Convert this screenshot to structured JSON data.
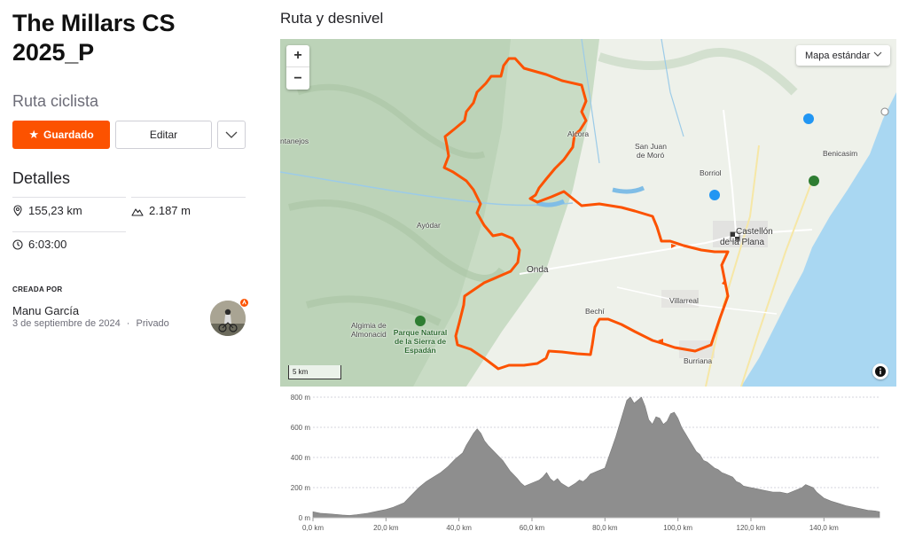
{
  "route": {
    "title": "The Millars CS 2025_P",
    "type": "Ruta ciclista"
  },
  "actions": {
    "saved_label": "Guardado",
    "edit_label": "Editar"
  },
  "details": {
    "heading": "Detalles",
    "distance": "155,23 km",
    "elevation": "2.187 m",
    "time": "6:03:00"
  },
  "creator": {
    "label": "CREADA POR",
    "name": "Manu García",
    "date": "3 de septiembre de 2024",
    "separator": "·",
    "privacy": "Privado"
  },
  "map": {
    "section_title": "Ruta y desnivel",
    "zoom_in": "+",
    "zoom_out": "−",
    "style_select": "Mapa estándar",
    "scale_label": "5 km",
    "labels": {
      "alcora": "Alcora",
      "san_juan": "San Juan",
      "de_moro": "de Moró",
      "borriol": "Borriol",
      "benicasim": "Benicasim",
      "castellon_1": "Castellón",
      "castellon_2": "de la Plana",
      "onda": "Onda",
      "villarreal": "Villarreal",
      "bechi": "Bechí",
      "burriana": "Burriana",
      "ayodar": "Ayódar",
      "algimia_1": "Algimia de",
      "algimia_2": "Almonacid",
      "park_1": "Parque Natural",
      "park_2": "de la Sierra de",
      "park_3": "Espadán",
      "tanejos": "ntanejos"
    },
    "route_color": "#fc5200"
  },
  "chart_data": {
    "type": "area",
    "title": "",
    "xlabel": "",
    "ylabel": "",
    "xlim": [
      0,
      155.23
    ],
    "ylim": [
      0,
      800
    ],
    "x_ticks": [
      0,
      20,
      40,
      60,
      80,
      100,
      120,
      140
    ],
    "x_tick_labels": [
      "0,0 km",
      "20,0 km",
      "40,0 km",
      "60,0 km",
      "80,0 km",
      "100,0 km",
      "120,0 km",
      "140,0 km"
    ],
    "y_ticks": [
      0,
      200,
      400,
      600,
      800
    ],
    "y_tick_labels": [
      "0 m",
      "200 m",
      "400 m",
      "600 m",
      "800 m"
    ],
    "grid": true,
    "fill_color": "#8e8e8e",
    "series": [
      {
        "x": [
          0,
          2,
          5,
          8,
          10,
          12,
          15,
          18,
          20,
          22,
          25,
          27,
          29,
          31,
          33,
          35,
          37,
          39,
          41,
          42,
          43,
          44,
          45,
          46,
          47,
          48,
          50,
          52,
          54,
          56,
          57,
          58,
          60,
          62,
          63,
          64,
          65,
          66,
          67,
          68,
          70,
          72,
          73,
          74,
          75,
          76,
          77,
          78,
          79,
          80,
          81,
          82,
          83,
          84,
          85,
          86,
          87,
          88,
          89,
          90,
          91,
          92,
          93,
          94,
          95,
          96,
          97,
          98,
          99,
          100,
          101,
          102,
          103,
          104,
          105,
          106,
          107,
          108,
          109,
          110,
          111,
          112,
          113,
          114,
          115,
          116,
          117,
          118,
          120,
          122,
          124,
          126,
          128,
          130,
          132,
          134,
          135,
          136,
          137,
          138,
          140,
          142,
          144,
          146,
          148,
          150,
          152,
          154,
          155.23
        ],
        "y": [
          40,
          30,
          25,
          18,
          15,
          20,
          30,
          45,
          55,
          70,
          100,
          150,
          200,
          240,
          270,
          300,
          340,
          390,
          430,
          480,
          520,
          560,
          590,
          560,
          510,
          480,
          430,
          380,
          310,
          260,
          230,
          210,
          230,
          250,
          270,
          300,
          260,
          240,
          260,
          230,
          200,
          230,
          250,
          240,
          260,
          290,
          300,
          310,
          320,
          330,
          400,
          470,
          540,
          620,
          700,
          780,
          800,
          760,
          780,
          800,
          740,
          650,
          620,
          670,
          660,
          620,
          640,
          690,
          700,
          660,
          600,
          560,
          520,
          480,
          440,
          420,
          380,
          370,
          350,
          330,
          320,
          300,
          290,
          280,
          270,
          240,
          230,
          210,
          200,
          190,
          180,
          170,
          170,
          160,
          180,
          200,
          220,
          210,
          200,
          170,
          130,
          110,
          95,
          80,
          70,
          60,
          50,
          45,
          40
        ]
      }
    ]
  }
}
